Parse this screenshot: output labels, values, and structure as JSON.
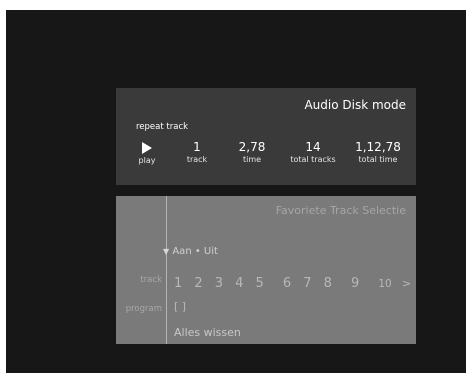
{
  "status": {
    "mode_title": "Audio Disk mode",
    "repeat_label": "repeat track",
    "play_label": "play",
    "track_value": "1",
    "track_label": "track",
    "time_value": "2,78",
    "time_label": "time",
    "total_tracks_value": "14",
    "total_tracks_label": "total tracks",
    "total_time_value": "1,12,78",
    "total_time_label": "total time",
    "play_icon": "play-icon"
  },
  "selection": {
    "title": "Favoriete Track Selectie",
    "toggle_label": "Aan • Uit",
    "toggle_icon": "triangle-down-icon",
    "track_row_label": "track",
    "program_row_label": "program",
    "tracks": [
      "1",
      "2",
      "3",
      "4",
      "5",
      "6",
      "7",
      "8",
      "9",
      "10"
    ],
    "next_arrow": ">",
    "program_value": "[ ]",
    "clear_label": "Alles wissen"
  },
  "colors": {
    "screen_bg": "#171717",
    "status_panel_bg": "#3a3a3a",
    "selection_panel_bg": "#7a7a7a",
    "text_light": "#ffffff",
    "text_muted": "#a8a8a8"
  }
}
